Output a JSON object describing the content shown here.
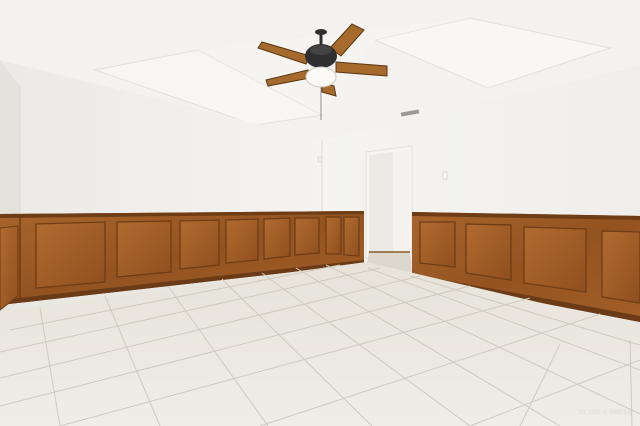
{
  "scene": {
    "subject": "empty-room",
    "ceiling_fan_blades": 5,
    "colors": {
      "wall": "#f3f2ef",
      "ceiling": "#f5f4f1",
      "wainscot": "#9a5a25",
      "wainscot_dark": "#6e3c15",
      "floor_tile": "#e9e5dc",
      "grout": "#cfcabe",
      "fan_body": "#2f2f2f",
      "fan_blade": "#a56a2c"
    }
  },
  "watermark": {
    "text": "SILVER & GREEN"
  }
}
